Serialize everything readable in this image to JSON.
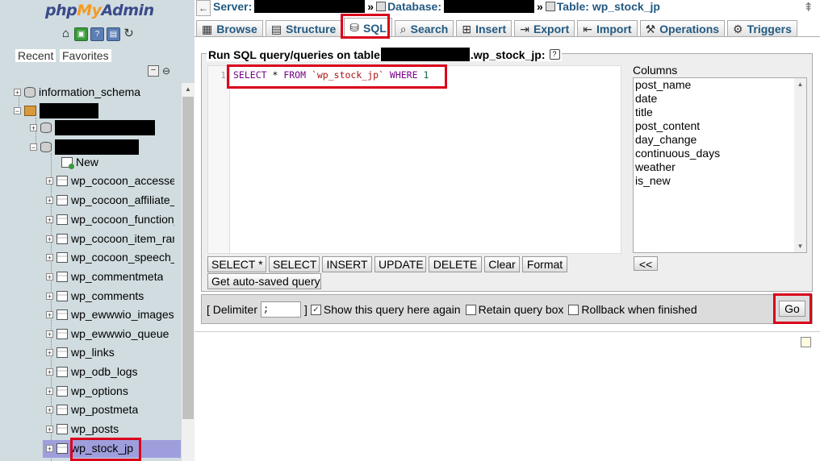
{
  "logo": {
    "php": "php",
    "my": "My",
    "admin": "Admin"
  },
  "nav": {
    "icons": [
      "home-icon",
      "sql-query-icon",
      "docs-icon",
      "settings-icon",
      "reload-icon"
    ],
    "recent": "Recent",
    "favorites": "Favorites",
    "tree": {
      "information_schema": "information_schema",
      "new": "New",
      "tables": [
        "wp_cocoon_accesses",
        "wp_cocoon_affiliate_ta",
        "wp_cocoon_function_t",
        "wp_cocoon_item_rank",
        "wp_cocoon_speech_b",
        "wp_commentmeta",
        "wp_comments",
        "wp_ewwwio_images",
        "wp_ewwwio_queue",
        "wp_links",
        "wp_odb_logs",
        "wp_options",
        "wp_postmeta",
        "wp_posts",
        "wp_stock_jp"
      ]
    }
  },
  "breadcrumb": {
    "server": "Server:",
    "database": "Database:",
    "table": "Table: wp_stock_jp",
    "sep": "»"
  },
  "tabs": [
    {
      "label": "Browse",
      "icon": "▦"
    },
    {
      "label": "Structure",
      "icon": "▤"
    },
    {
      "label": "SQL",
      "icon": "⛁"
    },
    {
      "label": "Search",
      "icon": "⌕"
    },
    {
      "label": "Insert",
      "icon": "⊞"
    },
    {
      "label": "Export",
      "icon": "⇥"
    },
    {
      "label": "Import",
      "icon": "⇤"
    },
    {
      "label": "Operations",
      "icon": "⚒"
    },
    {
      "label": "Triggers",
      "icon": "⚙"
    }
  ],
  "sql_panel": {
    "legend_prefix": "Run SQL query/queries on table",
    "legend_suffix": ".wp_stock_jp:",
    "help": "?",
    "line_number": "1",
    "query": {
      "select": "SELECT",
      "star": " * ",
      "from": "FROM",
      "table": " `wp_stock_jp` ",
      "where": "WHERE",
      "one": " 1"
    },
    "columns_label": "Columns",
    "columns": [
      "post_name",
      "date",
      "title",
      "post_content",
      "day_change",
      "continuous_days",
      "weather",
      "is_new"
    ],
    "insert_columns": "<<",
    "buttons": {
      "select_star": "SELECT *",
      "select": "SELECT",
      "insert": "INSERT",
      "update": "UPDATE",
      "delete": "DELETE",
      "clear": "Clear",
      "format": "Format",
      "autosaved": "Get auto-saved query"
    }
  },
  "options": {
    "delimiter_open": "[ Delimiter",
    "delimiter_value": ";",
    "delimiter_close": "]",
    "show_query": "Show this query here again",
    "show_query_checked": "✓",
    "retain": "Retain query box",
    "rollback": "Rollback when finished",
    "go": "Go"
  },
  "colors": {
    "highlight": "#d9001b",
    "link": "#235a81",
    "selected_row": "#9e9edc"
  }
}
